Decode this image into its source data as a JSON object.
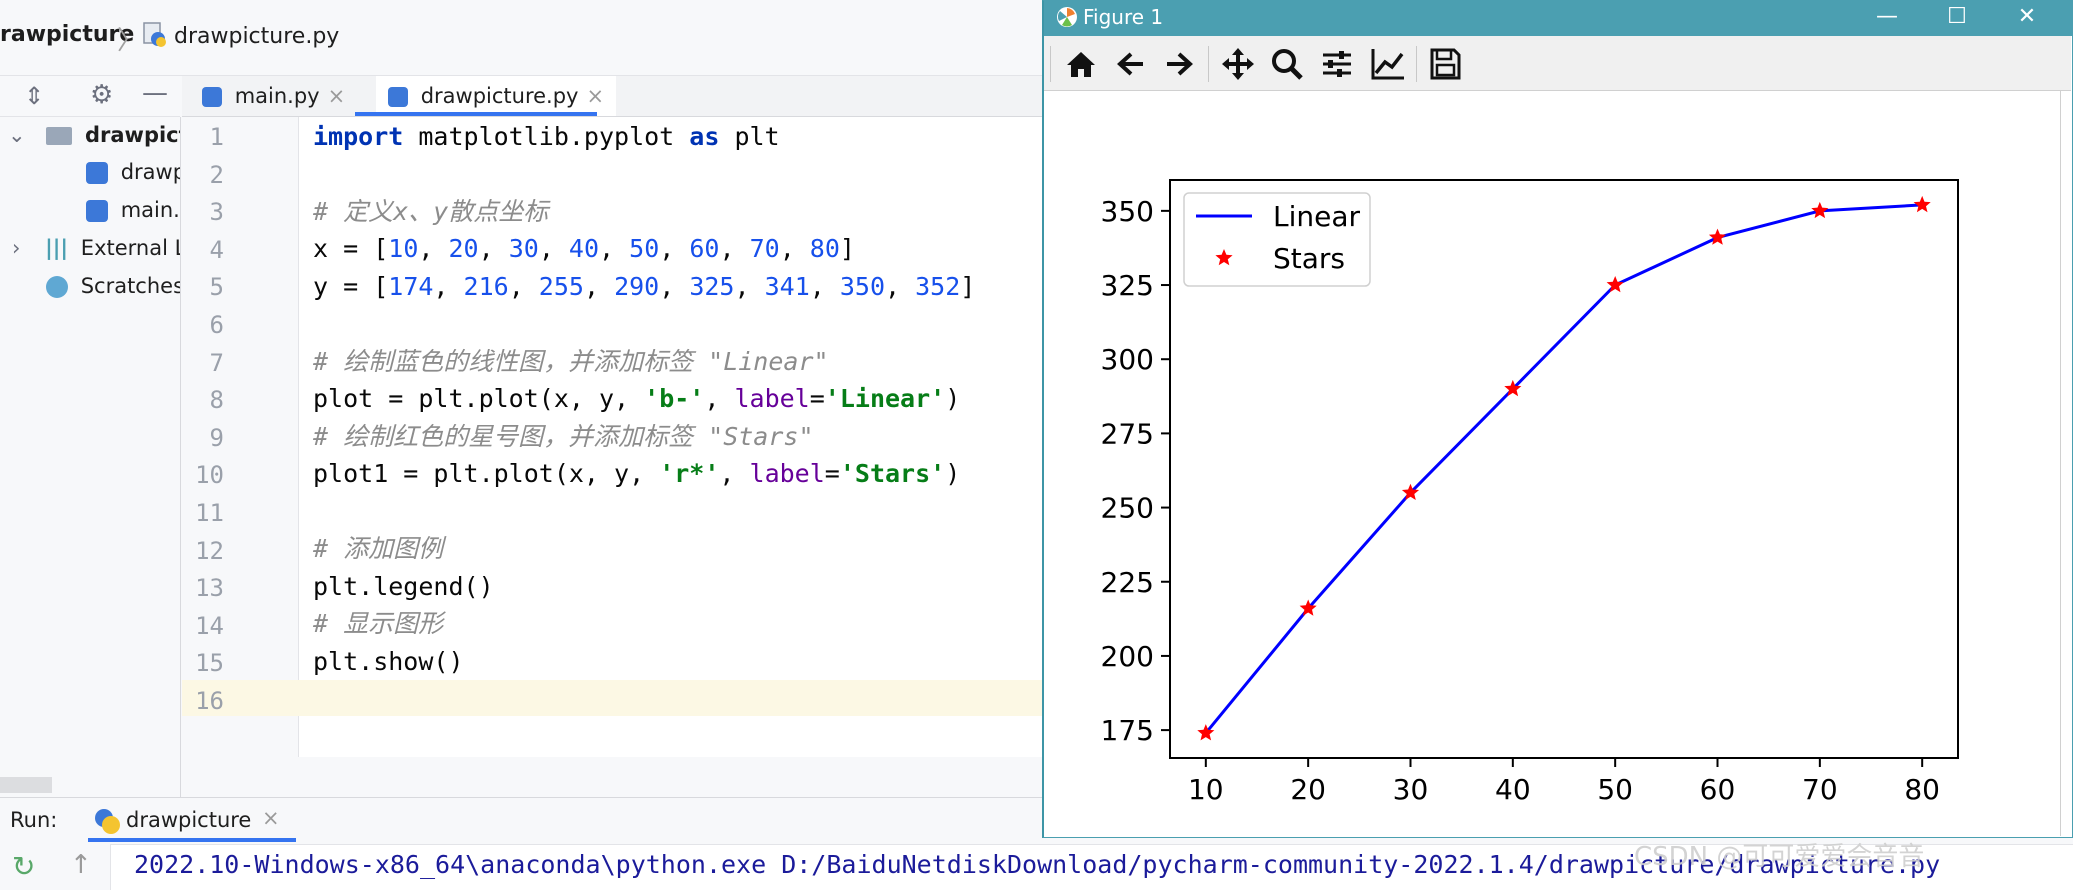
{
  "ide": {
    "breadcrumb": {
      "project": "rawpicture",
      "file": "drawpicture.py"
    },
    "tabs": [
      {
        "label": "main.py",
        "close": "×"
      },
      {
        "label": "drawpicture.py",
        "close": "×"
      }
    ],
    "project_tree": [
      {
        "label": "drawpictu",
        "kind": "folder",
        "expanded": true
      },
      {
        "label": "drawp",
        "kind": "python-file"
      },
      {
        "label": "main.p",
        "kind": "python-file"
      },
      {
        "label": "External L",
        "kind": "library",
        "expanded": false
      },
      {
        "label": "Scratches",
        "kind": "scratches"
      }
    ],
    "line_numbers": [
      "1",
      "2",
      "3",
      "4",
      "5",
      "6",
      "7",
      "8",
      "9",
      "10",
      "11",
      "12",
      "13",
      "14",
      "15",
      "16"
    ],
    "code": {
      "l1_kw1": "import",
      "l1_mod": " matplotlib.pyplot ",
      "l1_kw2": "as",
      "l1_alias": " plt",
      "l3_comment": "# 定义x、y散点坐标",
      "l4_prefix": "x = [",
      "l4_values": [
        "10",
        "20",
        "30",
        "40",
        "50",
        "60",
        "70",
        "80"
      ],
      "l5_prefix": "y = [",
      "l5_values": [
        "174",
        "216",
        "255",
        "290",
        "325",
        "341",
        "350",
        "352"
      ],
      "list_sep": ", ",
      "list_end": "]",
      "l7_comment": "# 绘制蓝色的线性图，并添加标签 \"Linear\"",
      "l8_a": "plot = plt.plot(x, y, ",
      "l8_fmt": "'b-'",
      "l8_b": ", ",
      "l8_param": "label",
      "l8_eq": "=",
      "l8_label": "'Linear'",
      "l8_end": ")",
      "l9_comment": "# 绘制红色的星号图，并添加标签 \"Stars\"",
      "l10_a": "plot1 = plt.plot(x, y, ",
      "l10_fmt": "'r*'",
      "l10_b": ", ",
      "l10_param": "label",
      "l10_eq": "=",
      "l10_label": "'Stars'",
      "l10_end": ")",
      "l12_comment": "# 添加图例",
      "l13": "plt.legend()",
      "l14_comment": "# 显示图形",
      "l15": "plt.show()"
    },
    "run": {
      "label": "Run:",
      "tab": "drawpicture",
      "tab_close": "×",
      "console_line": "2022.10-Windows-x86_64\\anaconda\\python.exe D:/BaiduNetdiskDownload/pycharm-community-2022.1.4/drawpicture/drawpicture.py"
    }
  },
  "figure_window": {
    "title": "Figure 1",
    "controls": {
      "minimize": "—",
      "maximize": "☐",
      "close": "✕"
    },
    "toolbar": [
      "home-icon",
      "back-icon",
      "forward-icon",
      "pan-icon",
      "zoom-icon",
      "configure-subplots-icon",
      "edit-axis-icon",
      "save-icon"
    ]
  },
  "chart_data": {
    "type": "line",
    "x": [
      10,
      20,
      30,
      40,
      50,
      60,
      70,
      80
    ],
    "series": [
      {
        "name": "Linear",
        "style": "line",
        "color": "#0000ff",
        "values": [
          174,
          216,
          255,
          290,
          325,
          341,
          350,
          352
        ]
      },
      {
        "name": "Stars",
        "style": "markers-star",
        "color": "#ff0000",
        "values": [
          174,
          216,
          255,
          290,
          325,
          341,
          350,
          352
        ]
      }
    ],
    "x_ticks": [
      10,
      20,
      30,
      40,
      50,
      60,
      70,
      80
    ],
    "y_ticks": [
      175,
      200,
      225,
      250,
      275,
      300,
      325,
      350
    ],
    "xlim": [
      6.5,
      83.5
    ],
    "ylim": [
      165.6,
      360.4
    ],
    "legend_position": "top-left",
    "grid": false,
    "title": "",
    "xlabel": "",
    "ylabel": ""
  },
  "watermark": "CSDN @可可爱爱会音音"
}
